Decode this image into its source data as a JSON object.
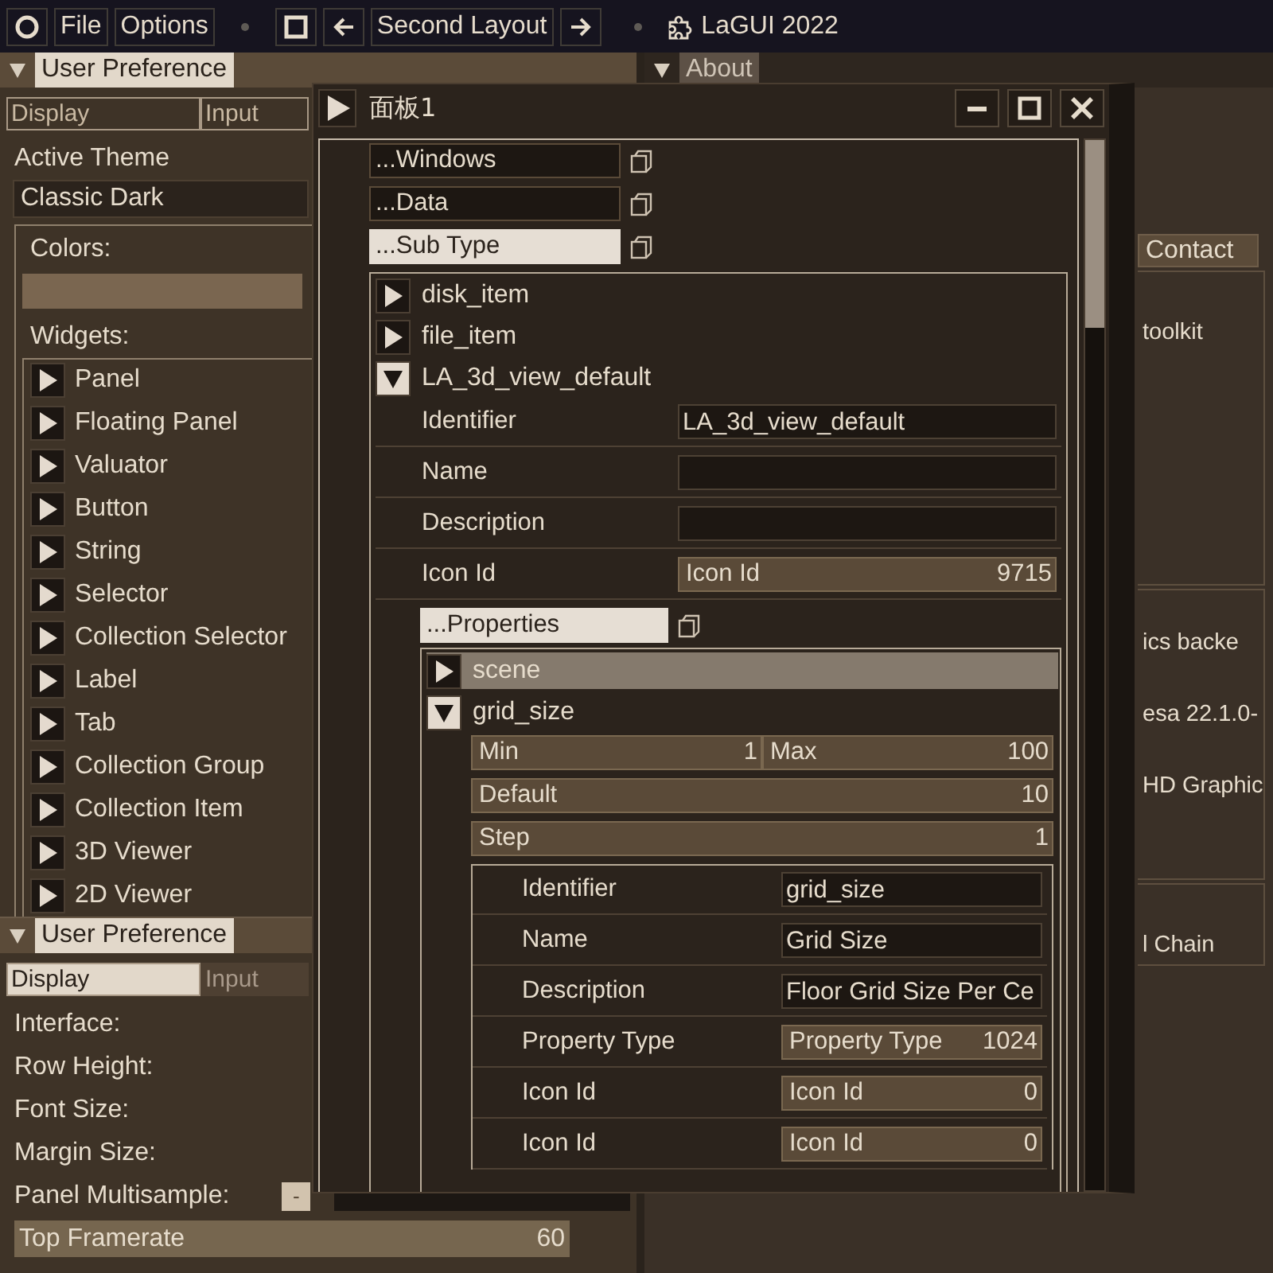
{
  "menu_bar": {
    "file_label": "File",
    "options_label": "Options",
    "layout_name": "Second Layout",
    "app_title": "LaGUI 2022"
  },
  "preference_window": {
    "title": "User Preference",
    "expanded": true,
    "tabs": [
      {
        "label": "Display",
        "selected": false
      },
      {
        "label": "Input",
        "selected": false
      }
    ],
    "theme_label": "Active Theme",
    "theme_value": "Classic Dark",
    "colors_label": "Colors:",
    "widgets_label": "Widgets:",
    "widgets": [
      {
        "label": "Panel",
        "expanded": false
      },
      {
        "label": "Floating Panel",
        "expanded": false
      },
      {
        "label": "Valuator",
        "expanded": false
      },
      {
        "label": "Button",
        "expanded": false
      },
      {
        "label": "String",
        "expanded": false
      },
      {
        "label": "Selector",
        "expanded": false
      },
      {
        "label": "Collection Selector",
        "expanded": false
      },
      {
        "label": "Label",
        "expanded": false
      },
      {
        "label": "Tab",
        "expanded": false
      },
      {
        "label": "Collection Group",
        "expanded": false
      },
      {
        "label": "Collection Item",
        "expanded": false
      },
      {
        "label": "3D Viewer",
        "expanded": false
      },
      {
        "label": "2D Viewer",
        "expanded": false
      }
    ]
  },
  "display_window": {
    "title": "User Preference",
    "expanded": true,
    "tabs": [
      {
        "label": "Display",
        "selected": true
      },
      {
        "label": "Input",
        "selected": false
      }
    ],
    "rows": [
      "Interface:",
      "Row Height:",
      "Font Size:",
      "Margin Size:",
      "Panel Multisample:"
    ],
    "multisample_button": "-",
    "framerate": {
      "label": "Top Framerate",
      "value": "60"
    }
  },
  "about_window": {
    "title": "About",
    "expanded": true,
    "tab": "Contact",
    "sections": [
      {
        "lines": [
          "toolkit"
        ]
      },
      {
        "lines": [
          "ics backe",
          "esa 22.1.0-",
          "HD Graphic"
        ]
      },
      {
        "lines": [
          "l Chain"
        ]
      }
    ]
  },
  "floating_panel": {
    "title": "面板1",
    "sections": [
      {
        "label": "...Windows",
        "selected": false
      },
      {
        "label": "...Data",
        "selected": false
      },
      {
        "label": "...Sub Type",
        "selected": true
      }
    ],
    "tree": [
      {
        "label": "disk_item",
        "expanded": false
      },
      {
        "label": "file_item",
        "expanded": false
      },
      {
        "label": "LA_3d_view_default",
        "expanded": true,
        "fields": [
          {
            "label": "Identifier",
            "kind": "text",
            "value": "LA_3d_view_default"
          },
          {
            "label": "Name",
            "kind": "text"
          },
          {
            "label": "Description",
            "kind": "text"
          },
          {
            "label": "Icon Id",
            "kind": "number",
            "field_label": "Icon Id",
            "value": "9715"
          }
        ],
        "properties_button": {
          "label": "...Properties",
          "selected": true
        },
        "properties": [
          {
            "label": "scene",
            "expanded": false,
            "highlighted": true
          },
          {
            "label": "grid_size",
            "expanded": true,
            "highlighted": false,
            "range": {
              "min_label": "Min",
              "min": "1",
              "max_label": "Max",
              "max": "100"
            },
            "values": [
              {
                "label": "Default",
                "value": "10"
              },
              {
                "label": "Step",
                "value": "1"
              }
            ],
            "fields": [
              {
                "label": "Identifier",
                "kind": "text",
                "value": "grid_size"
              },
              {
                "label": "Name",
                "kind": "text",
                "value": "Grid Size"
              },
              {
                "label": "Description",
                "kind": "text",
                "value": "Floor Grid Size Per Ce"
              },
              {
                "label": "Property Type",
                "kind": "number",
                "field_label": "Property Type",
                "value": "1024"
              },
              {
                "label": "Icon Id",
                "kind": "number",
                "field_label": "Icon Id",
                "value": "0"
              },
              {
                "label": "Icon Id",
                "kind": "number",
                "field_label": "Icon Id",
                "value": "0"
              }
            ]
          }
        ]
      }
    ]
  }
}
